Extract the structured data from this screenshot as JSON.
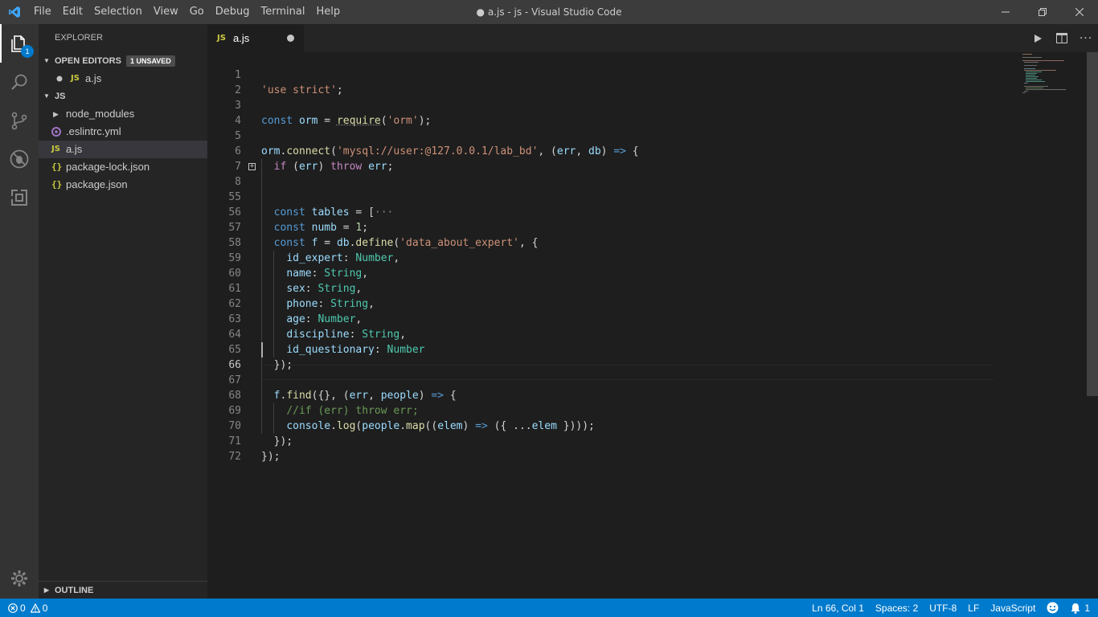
{
  "window": {
    "title": "● a.js - js - Visual Studio Code",
    "menu": [
      "File",
      "Edit",
      "Selection",
      "View",
      "Go",
      "Debug",
      "Terminal",
      "Help"
    ]
  },
  "activity_bar": {
    "explorer_badge": "1",
    "items": [
      "files-icon",
      "search-icon",
      "source-control-icon",
      "debug-icon",
      "extensions-icon",
      "gear-icon"
    ]
  },
  "sidebar": {
    "header": "EXPLORER",
    "open_editors": {
      "label": "OPEN EDITORS",
      "badge": "1 UNSAVED",
      "files": [
        "a.js"
      ]
    },
    "folder": {
      "label": "JS",
      "items": [
        {
          "name": "node_modules",
          "type": "folder"
        },
        {
          "name": ".eslintrc.yml",
          "type": "yml"
        },
        {
          "name": "a.js",
          "type": "js",
          "selected": true
        },
        {
          "name": "package-lock.json",
          "type": "json"
        },
        {
          "name": "package.json",
          "type": "json"
        }
      ]
    },
    "outline_label": "OUTLINE"
  },
  "editor": {
    "tab": {
      "label": "a.js",
      "icon": "JS",
      "dirty": true
    },
    "current_line": 66,
    "lines": [
      {
        "n": "1",
        "code": "'use strict';"
      },
      {
        "n": "2",
        "code": ""
      },
      {
        "n": "3",
        "code": "const orm = require('orm');"
      },
      {
        "n": "4",
        "code": ""
      },
      {
        "n": "5",
        "code": "orm.connect('mysql://user:@127.0.0.1/lab_bd', (err, db) => {"
      },
      {
        "n": "6",
        "code": "  if (err) throw err;"
      },
      {
        "n": "7",
        "code": ""
      },
      {
        "n": "8",
        "code": "  const tables = [···"
      },
      {
        "n": "55",
        "code": ""
      },
      {
        "n": "56",
        "code": "  const numb = 1;"
      },
      {
        "n": "57",
        "code": "  const f = db.define('data_about_expert', {"
      },
      {
        "n": "58",
        "code": "    id_expert: Number,"
      },
      {
        "n": "59",
        "code": "    name: String,"
      },
      {
        "n": "60",
        "code": "    sex: String,"
      },
      {
        "n": "61",
        "code": "    phone: String,"
      },
      {
        "n": "62",
        "code": "    age: Number,"
      },
      {
        "n": "63",
        "code": "    discipline: String,"
      },
      {
        "n": "64",
        "code": "    id_questionary: Number"
      },
      {
        "n": "65",
        "code": "  });"
      },
      {
        "n": "66",
        "code": ""
      },
      {
        "n": "67",
        "code": "  f.find({}, (err, people) => {"
      },
      {
        "n": "68",
        "code": "    //if (err) throw err;"
      },
      {
        "n": "69",
        "code": "    console.log(people.map((elem) => ({ ...elem })));"
      },
      {
        "n": "70",
        "code": "  });"
      },
      {
        "n": "71",
        "code": "});"
      },
      {
        "n": "72",
        "code": ""
      }
    ]
  },
  "status_bar": {
    "errors": "0",
    "warnings": "0",
    "position": "Ln 66, Col 1",
    "indent": "Spaces: 2",
    "encoding": "UTF-8",
    "eol": "LF",
    "language": "JavaScript",
    "notifications": "1"
  },
  "colors": {
    "accent": "#007acc",
    "titlebar": "#3c3c3c",
    "activitybar": "#333333",
    "sidebar": "#252526",
    "editor": "#1e1e1e"
  }
}
